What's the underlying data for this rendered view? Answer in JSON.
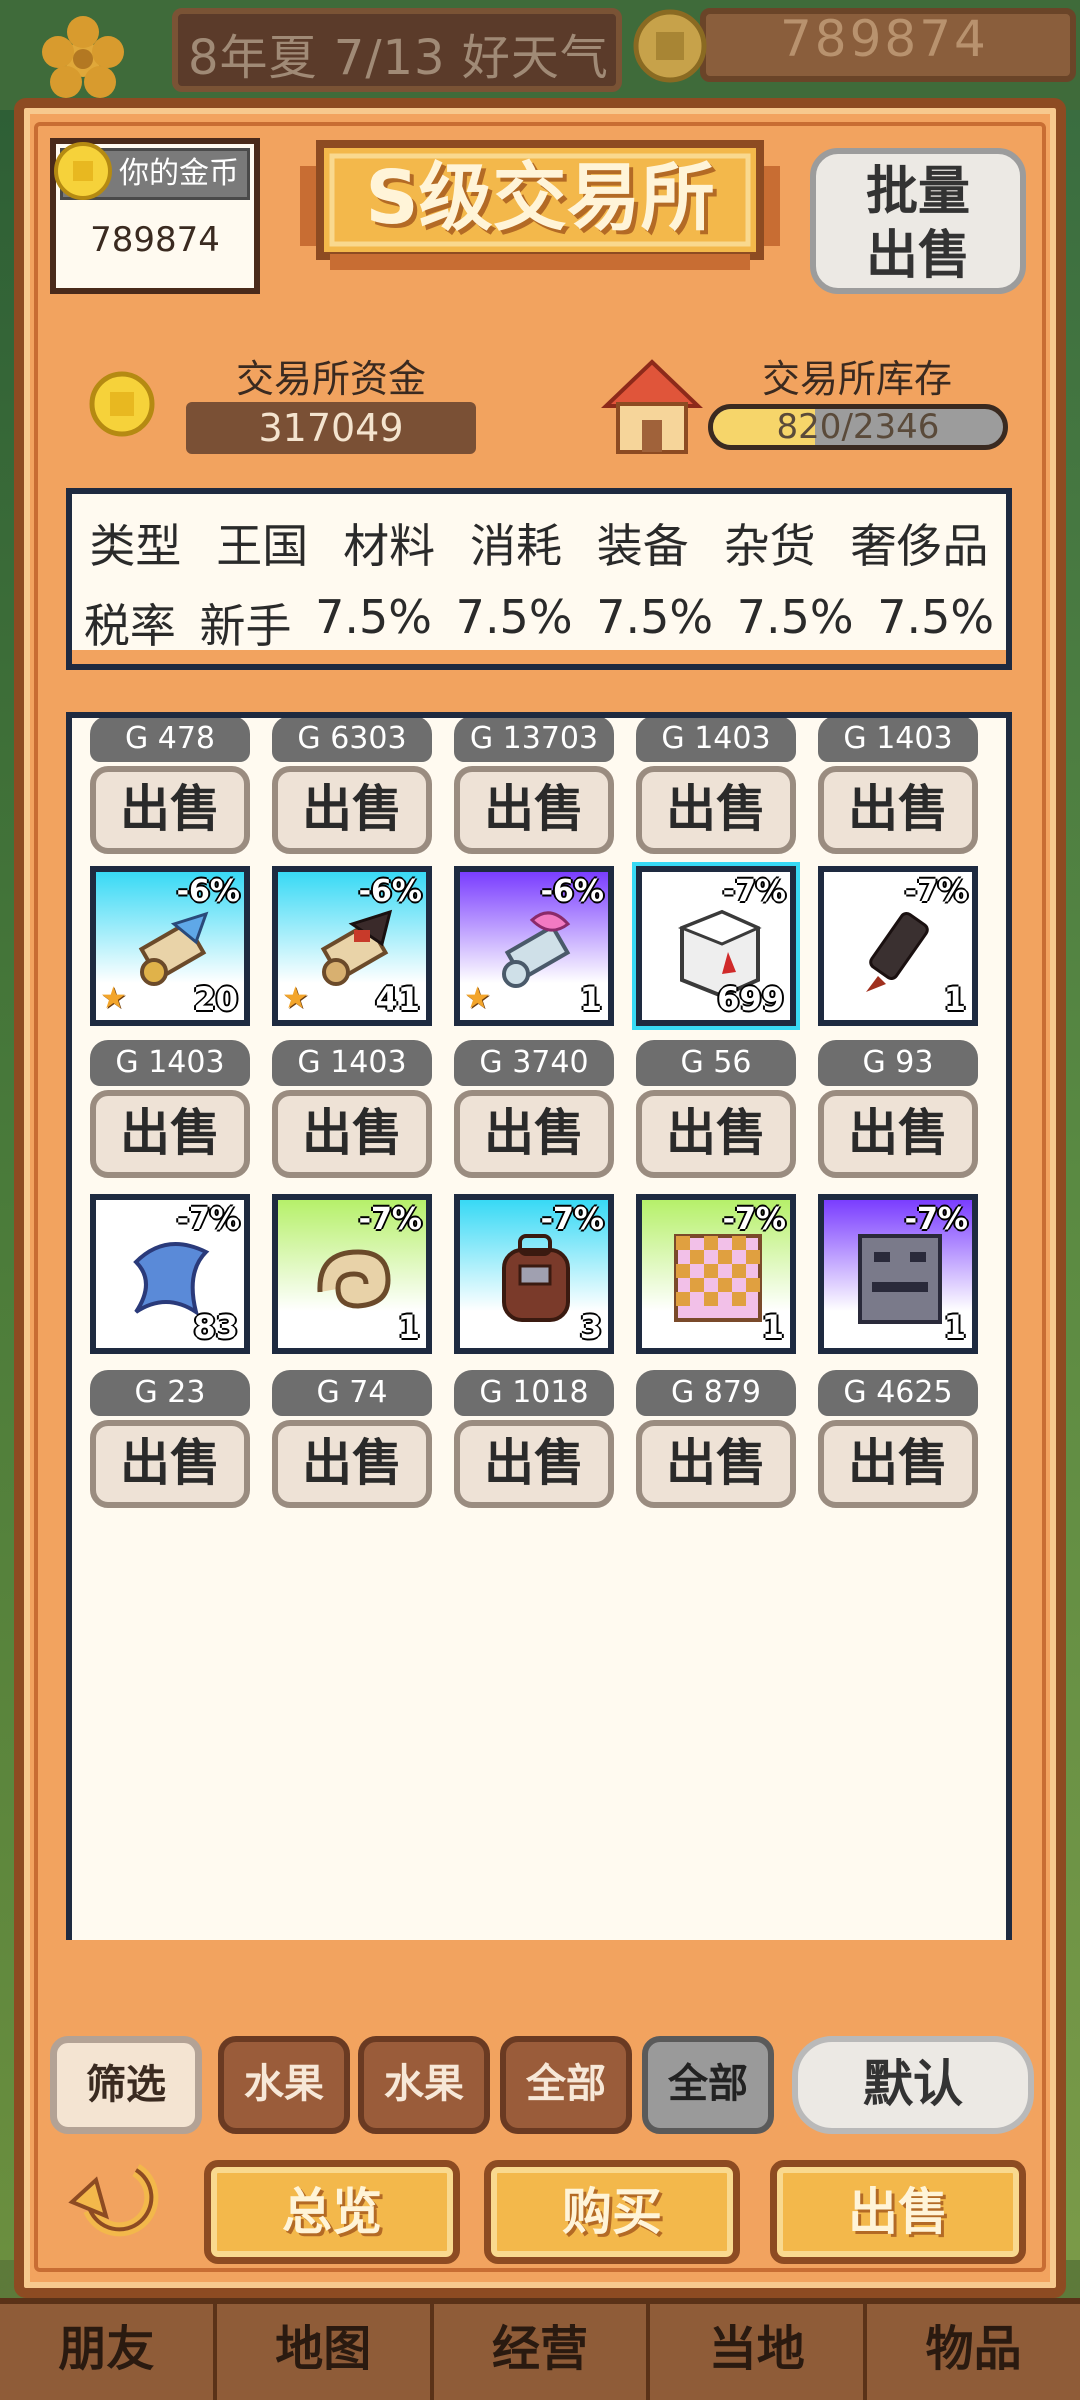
{
  "top_bar": {
    "date_text": "8年夏 7/13 好天气",
    "gold": "789874"
  },
  "panel": {
    "your_gold_label": "你的金币",
    "your_gold_value": "789874",
    "title": "S级交易所",
    "batch_sell_line1": "批量",
    "batch_sell_line2": "出售",
    "fund_label": "交易所资金",
    "fund_value": "317049",
    "stock_label": "交易所库存",
    "stock_value": "820/2346",
    "stock_fraction": 0.35
  },
  "tax_table": {
    "headers": [
      "类型",
      "王国",
      "材料",
      "消耗",
      "装备",
      "杂货",
      "奢侈品"
    ],
    "values": [
      "税率",
      "新手",
      "7.5%",
      "7.5%",
      "7.5%",
      "7.5%",
      "7.5%"
    ]
  },
  "sell_label": "出售",
  "row0_prices": [
    "G 478",
    "G 6303",
    "G 13703",
    "G 1403",
    "G 1403"
  ],
  "items_row1": [
    {
      "discount": "-6%",
      "qty": "20",
      "price": "G 1403",
      "icon": "scroll-blue-icon",
      "bg": "cyan",
      "star": true
    },
    {
      "discount": "-6%",
      "qty": "41",
      "price": "G 1403",
      "icon": "scroll-red-icon",
      "bg": "cyan",
      "star": true
    },
    {
      "discount": "-6%",
      "qty": "1",
      "price": "G 3740",
      "icon": "scroll-pink-icon",
      "bg": "purple",
      "star": true
    },
    {
      "discount": "-7%",
      "qty": "699",
      "price": "G 56",
      "icon": "blood-box-icon",
      "bg": "white",
      "star": false
    },
    {
      "discount": "-7%",
      "qty": "1",
      "price": "G 93",
      "icon": "dagger-icon",
      "bg": "white",
      "star": false
    }
  ],
  "items_row2": [
    {
      "discount": "-7%",
      "qty": "83",
      "price": "G 23",
      "icon": "blue-feather-icon",
      "bg": "white",
      "star": false
    },
    {
      "discount": "-7%",
      "qty": "1",
      "price": "G 74",
      "icon": "shell-icon",
      "bg": "lime",
      "star": false
    },
    {
      "discount": "-7%",
      "qty": "3",
      "price": "G 1018",
      "icon": "backpack-icon",
      "bg": "cyan",
      "star": false
    },
    {
      "discount": "-7%",
      "qty": "1",
      "price": "G 879",
      "icon": "checkered-cloth-icon",
      "bg": "lime",
      "star": false
    },
    {
      "discount": "-7%",
      "qty": "1",
      "price": "G 4625",
      "icon": "robot-box-icon",
      "bg": "purple",
      "star": false
    }
  ],
  "filters": {
    "filter": "筛选",
    "f1": "水果",
    "f2": "水果",
    "f3": "全部",
    "f4": "全部",
    "default": "默认"
  },
  "actions": {
    "overview": "总览",
    "buy": "购买",
    "sell": "出售"
  },
  "nav": [
    "朋友",
    "地图",
    "经营",
    "当地",
    "物品"
  ]
}
